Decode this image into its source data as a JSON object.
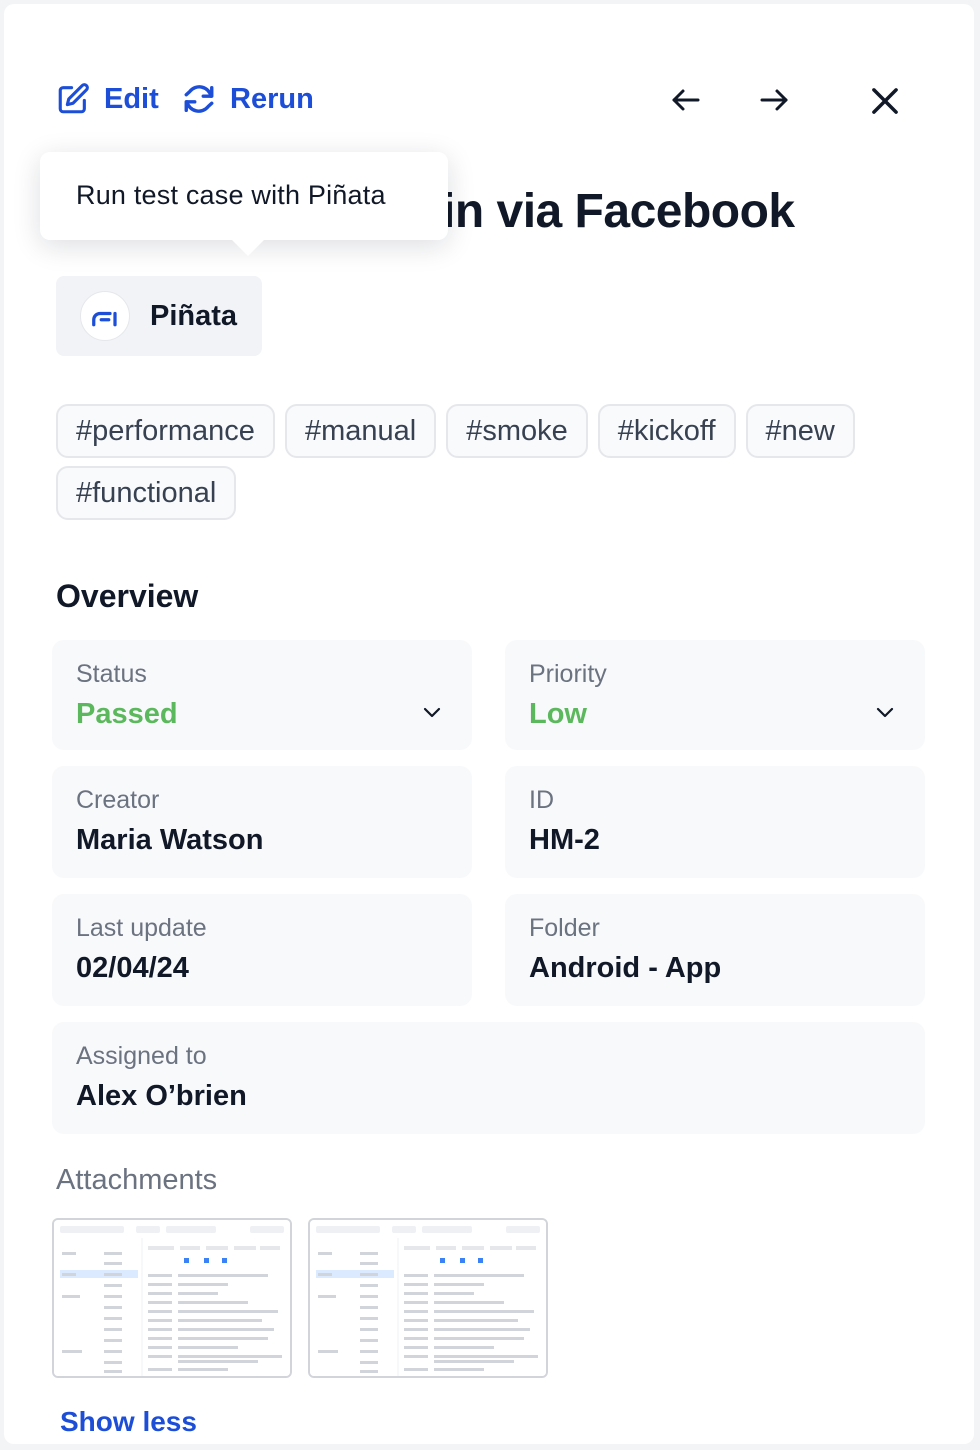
{
  "toolbar": {
    "edit_label": "Edit",
    "rerun_label": "Rerun",
    "icons": [
      "edit-icon",
      "refresh-icon",
      "arrow-left-icon",
      "arrow-right-icon",
      "close-icon"
    ]
  },
  "test_case": {
    "title_visible": "in via Facebook"
  },
  "tooltip": {
    "text": "Run test case with Piñata"
  },
  "tool_chip": {
    "name": "Piñata"
  },
  "tags": [
    "#performance",
    "#manual",
    "#smoke",
    "#kickoff",
    "#new",
    "#functional"
  ],
  "overview": {
    "title": "Overview",
    "status": {
      "label": "Status",
      "value": "Passed",
      "color": "#5cb85c"
    },
    "priority": {
      "label": "Priority",
      "value": "Low",
      "color": "#5cb85c"
    },
    "creator": {
      "label": "Creator",
      "value": "Maria Watson"
    },
    "id": {
      "label": "ID",
      "value": "HM-2"
    },
    "last_update": {
      "label": "Last update",
      "value": "02/04/24"
    },
    "folder": {
      "label": "Folder",
      "value": "Android - App"
    },
    "assigned_to": {
      "label": "Assigned to",
      "value": "Alex O’brien"
    }
  },
  "attachments": {
    "title": "Attachments",
    "count": 2
  },
  "footer": {
    "show_less_label": "Show less"
  },
  "colors": {
    "accent": "#1d4ed8",
    "success": "#5cb85c",
    "card_bg": "#f8f9fb"
  }
}
